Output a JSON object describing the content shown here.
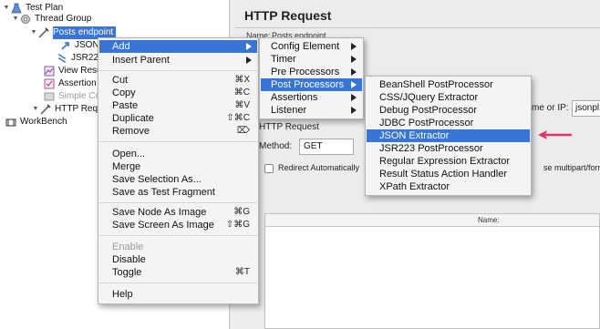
{
  "tree": {
    "items": [
      {
        "label": "Test Plan"
      },
      {
        "label": "Thread Group"
      },
      {
        "label": "Posts endpoint"
      },
      {
        "label": "JSON E"
      },
      {
        "label": "JSR223"
      },
      {
        "label": "View Resu"
      },
      {
        "label": "Assertion"
      },
      {
        "label": "Simple Co"
      },
      {
        "label": "HTTP Req"
      },
      {
        "label": "WorkBench"
      }
    ]
  },
  "panel": {
    "title": "HTTP Request",
    "name_label": "Name:",
    "name_value": "Posts endpoint",
    "domain_label": "me or IP:",
    "domain_value": "jsonpl",
    "http_label": "HTTP Request",
    "method_label": "Method:",
    "method_value": "GET",
    "redirect_label": "Redirect Automatically",
    "multipart_label": "se multipart/form-d",
    "table_name_header": "Name:"
  },
  "context_menu": {
    "add": "Add",
    "insert_parent": "Insert Parent",
    "cut": "Cut",
    "cut_sc": "⌘X",
    "copy": "Copy",
    "copy_sc": "⌘C",
    "paste": "Paste",
    "paste_sc": "⌘V",
    "duplicate": "Duplicate",
    "duplicate_sc": "⇧⌘C",
    "remove": "Remove",
    "remove_sc": "⌦",
    "open": "Open...",
    "merge": "Merge",
    "save_selection": "Save Selection As...",
    "save_fragment": "Save as Test Fragment",
    "save_node_image": "Save Node As Image",
    "save_node_image_sc": "⌘G",
    "save_screen_image": "Save Screen As Image",
    "save_screen_image_sc": "⇧⌘G",
    "enable": "Enable",
    "disable": "Disable",
    "toggle": "Toggle",
    "toggle_sc": "⌘T",
    "help": "Help"
  },
  "add_menu": {
    "config_element": "Config Element",
    "timer": "Timer",
    "pre_processors": "Pre Processors",
    "post_processors": "Post Processors",
    "assertions": "Assertions",
    "listener": "Listener"
  },
  "post_processors_menu": {
    "items": [
      "BeanShell PostProcessor",
      "CSS/JQuery Extractor",
      "Debug PostProcessor",
      "JDBC PostProcessor",
      "JSON Extractor",
      "JSR223 PostProcessor",
      "Regular Expression Extractor",
      "Result Status Action Handler",
      "XPath Extractor"
    ]
  },
  "colors": {
    "highlight": "#3875d7",
    "annotation_arrow": "#e8336d"
  }
}
